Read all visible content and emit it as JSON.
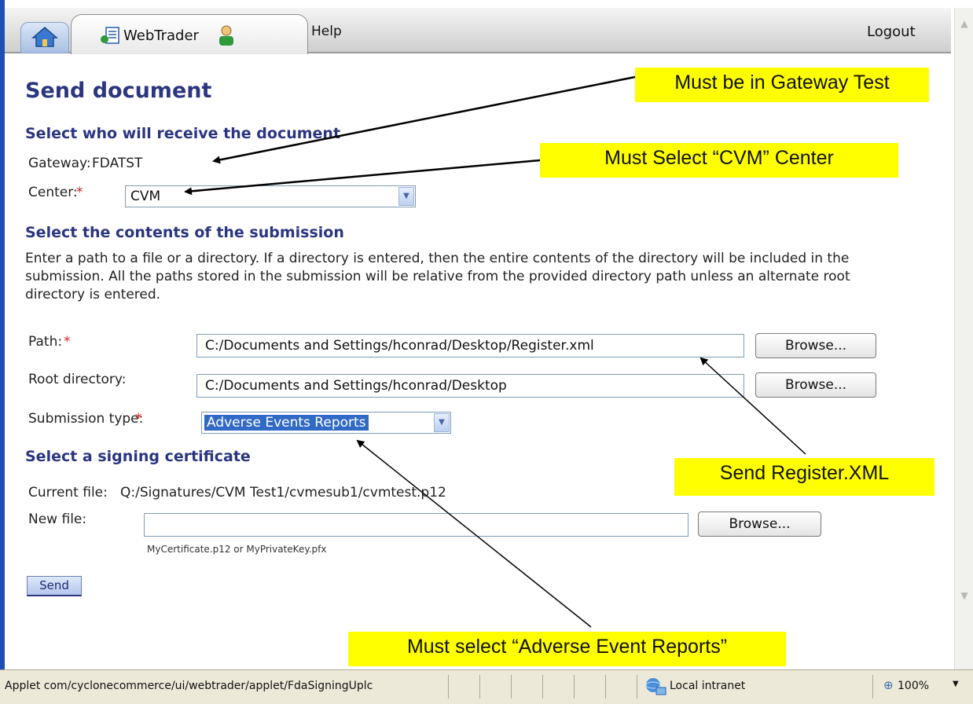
{
  "nav": {
    "home_icon": "home-icon",
    "webtrader_tab": "WebTrader",
    "help": "Help",
    "logout": "Logout"
  },
  "page": {
    "title": "Send document",
    "recipient_heading": "Select who will receive the document",
    "gateway_label": "Gateway:",
    "gateway_value": "FDATST",
    "center_label": "Center:",
    "required_marker": "*",
    "center_selected": "CVM",
    "contents_heading": "Select the contents of the submission",
    "contents_paragraph": "Enter a path to a file or a directory. If a directory is entered, then the entire contents of the directory will be included in the submission. All the paths stored in the submission will be relative from the provided directory path unless an alternate root directory is entered.",
    "path_label": "Path:",
    "path_value": "C:/Documents and Settings/hconrad/Desktop/Register.xml",
    "root_label": "Root directory:",
    "root_value": "C:/Documents and Settings/hconrad/Desktop",
    "submission_type_label": "Submission type:",
    "submission_type_selected": "Adverse Events Reports",
    "browse_label": "Browse...",
    "cert_heading": "Select a signing certificate",
    "current_file_label": "Current file:",
    "current_file_value": "Q:/Signatures/CVM Test1/cvmesub1/cvmtest.p12",
    "new_file_label": "New file:",
    "new_file_value": "",
    "new_file_hint": "MyCertificate.p12 or MyPrivateKey.pfx",
    "send_label": "Send"
  },
  "annotations": {
    "gateway_note": "Must be in Gateway Test",
    "center_note": "Must Select “CVM” Center",
    "register_note": "Send Register.XML",
    "adverse_note": "Must select “Adverse Event Reports”",
    "highlight_color": "#ffff00"
  },
  "statusbar": {
    "message": "Applet com/cyclonecommerce/ui/webtrader/applet/FdaSigningUplc",
    "zone": "Local intranet",
    "zoom": "100%"
  },
  "colors": {
    "heading": "#2b3580",
    "required": "#e02020",
    "frame": "#1f4fb3"
  }
}
